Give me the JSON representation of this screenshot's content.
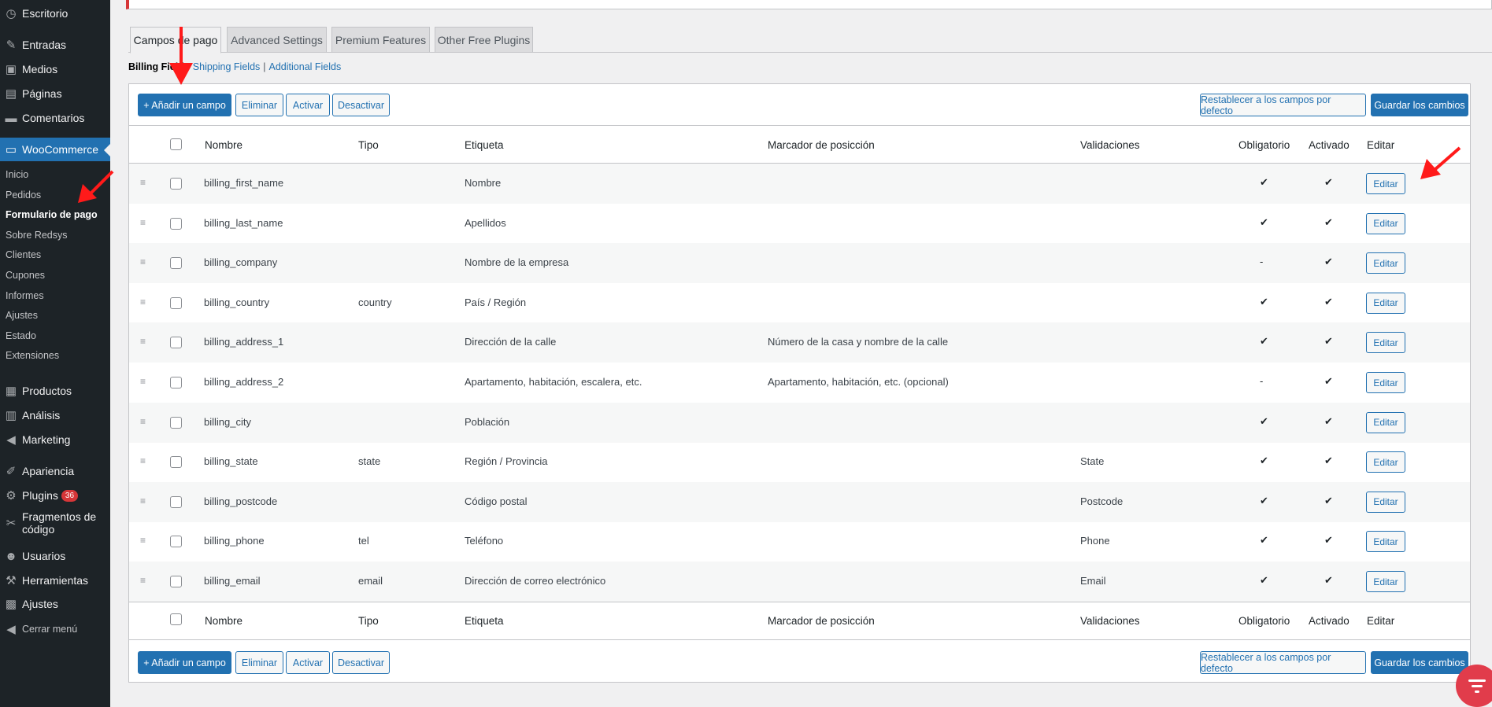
{
  "sidebar": {
    "menu": [
      {
        "icon": "dashboard-icon",
        "label": "Escritorio"
      },
      {
        "icon": "pin-icon",
        "label": "Entradas"
      },
      {
        "icon": "media-icon",
        "label": "Medios"
      },
      {
        "icon": "pages-icon",
        "label": "Páginas"
      },
      {
        "icon": "comments-icon",
        "label": "Comentarios"
      },
      {
        "icon": "woocommerce-icon",
        "label": "WooCommerce"
      },
      {
        "icon": "products-icon",
        "label": "Productos"
      },
      {
        "icon": "analytics-icon",
        "label": "Análisis"
      },
      {
        "icon": "marketing-icon",
        "label": "Marketing"
      },
      {
        "icon": "appearance-icon",
        "label": "Apariencia"
      },
      {
        "icon": "plugins-icon",
        "label": "Plugins",
        "badge": "36"
      },
      {
        "icon": "scissors-icon",
        "label": "Fragmentos de código"
      },
      {
        "icon": "users-icon",
        "label": "Usuarios"
      },
      {
        "icon": "tools-icon",
        "label": "Herramientas"
      },
      {
        "icon": "settings-icon",
        "label": "Ajustes"
      },
      {
        "icon": "collapse-icon",
        "label": "Cerrar menú"
      }
    ],
    "submenu": [
      "Inicio",
      "Pedidos",
      "Formulario de pago",
      "Sobre Redsys",
      "Clientes",
      "Cupones",
      "Informes",
      "Ajustes",
      "Estado",
      "Extensiones"
    ],
    "submenu_current": "Formulario de pago"
  },
  "tabs": [
    "Campos de pago",
    "Advanced Settings",
    "Premium Features",
    "Other Free Plugins"
  ],
  "subsub": {
    "current": "Billing Fields",
    "links": [
      "Shipping Fields",
      "Additional Fields"
    ],
    "separator": "|"
  },
  "actions": {
    "add": "+ Añadir un campo",
    "remove": "Eliminar",
    "enable": "Activar",
    "disable": "Desactivar",
    "reset": "Restablecer a los campos por defecto",
    "save": "Guardar los cambios"
  },
  "table": {
    "headers": {
      "name": "Nombre",
      "type": "Tipo",
      "label": "Etiqueta",
      "placeholder": "Marcador de posicción",
      "validations": "Validaciones",
      "required": "Obligatorio",
      "enabled": "Activado",
      "edit": "Editar"
    },
    "edit_label": "Editar",
    "rows": [
      {
        "name": "billing_first_name",
        "type": "",
        "label": "Nombre",
        "placeholder": "",
        "validations": "",
        "required": "✔",
        "enabled": "✔"
      },
      {
        "name": "billing_last_name",
        "type": "",
        "label": "Apellidos",
        "placeholder": "",
        "validations": "",
        "required": "✔",
        "enabled": "✔"
      },
      {
        "name": "billing_company",
        "type": "",
        "label": "Nombre de la empresa",
        "placeholder": "",
        "validations": "",
        "required": "-",
        "enabled": "✔"
      },
      {
        "name": "billing_country",
        "type": "country",
        "label": "País / Región",
        "placeholder": "",
        "validations": "",
        "required": "✔",
        "enabled": "✔"
      },
      {
        "name": "billing_address_1",
        "type": "",
        "label": "Dirección de la calle",
        "placeholder": "Número de la casa y nombre de la calle",
        "validations": "",
        "required": "✔",
        "enabled": "✔"
      },
      {
        "name": "billing_address_2",
        "type": "",
        "label": "Apartamento, habitación, escalera, etc.",
        "placeholder": "Apartamento, habitación, etc. (opcional)",
        "validations": "",
        "required": "-",
        "enabled": "✔"
      },
      {
        "name": "billing_city",
        "type": "",
        "label": "Población",
        "placeholder": "",
        "validations": "",
        "required": "✔",
        "enabled": "✔"
      },
      {
        "name": "billing_state",
        "type": "state",
        "label": "Región / Provincia",
        "placeholder": "",
        "validations": "State",
        "required": "✔",
        "enabled": "✔"
      },
      {
        "name": "billing_postcode",
        "type": "",
        "label": "Código postal",
        "placeholder": "",
        "validations": "Postcode",
        "required": "✔",
        "enabled": "✔"
      },
      {
        "name": "billing_phone",
        "type": "tel",
        "label": "Teléfono",
        "placeholder": "",
        "validations": "Phone",
        "required": "✔",
        "enabled": "✔"
      },
      {
        "name": "billing_email",
        "type": "email",
        "label": "Dirección de correo electrónico",
        "placeholder": "",
        "validations": "Email",
        "required": "✔",
        "enabled": "✔"
      }
    ]
  },
  "colors": {
    "accent": "#2271b1",
    "sidebar": "#1d2327",
    "arrow": "#ff1a1a",
    "fab": "#e13c4b"
  }
}
